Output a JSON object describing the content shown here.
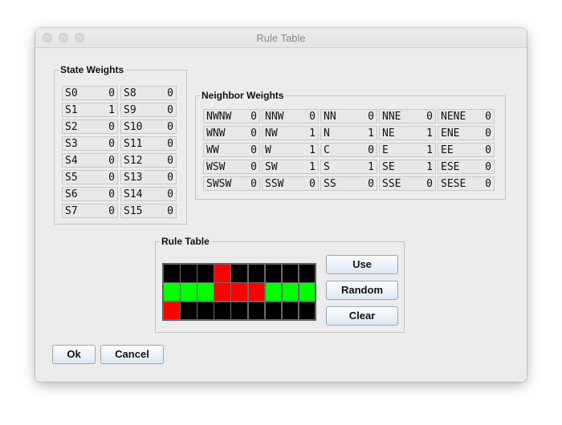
{
  "window": {
    "title": "Rule Table"
  },
  "state_weights": {
    "title": "State Weights",
    "left": [
      {
        "label": "S0",
        "value": "0"
      },
      {
        "label": "S1",
        "value": "1"
      },
      {
        "label": "S2",
        "value": "0"
      },
      {
        "label": "S3",
        "value": "0"
      },
      {
        "label": "S4",
        "value": "0"
      },
      {
        "label": "S5",
        "value": "0"
      },
      {
        "label": "S6",
        "value": "0"
      },
      {
        "label": "S7",
        "value": "0"
      }
    ],
    "right": [
      {
        "label": "S8",
        "value": "0"
      },
      {
        "label": "S9",
        "value": "0"
      },
      {
        "label": "S10",
        "value": "0"
      },
      {
        "label": "S11",
        "value": "0"
      },
      {
        "label": "S12",
        "value": "0"
      },
      {
        "label": "S13",
        "value": "0"
      },
      {
        "label": "S14",
        "value": "0"
      },
      {
        "label": "S15",
        "value": "0"
      }
    ]
  },
  "neighbor_weights": {
    "title": "Neighbor Weights",
    "rows": [
      [
        {
          "label": "NWNW",
          "value": "0"
        },
        {
          "label": "NNW",
          "value": "0"
        },
        {
          "label": "NN",
          "value": "0"
        },
        {
          "label": "NNE",
          "value": "0"
        },
        {
          "label": "NENE",
          "value": "0"
        }
      ],
      [
        {
          "label": "WNW",
          "value": "0"
        },
        {
          "label": "NW",
          "value": "1"
        },
        {
          "label": "N",
          "value": "1"
        },
        {
          "label": "NE",
          "value": "1"
        },
        {
          "label": "ENE",
          "value": "0"
        }
      ],
      [
        {
          "label": "WW",
          "value": "0"
        },
        {
          "label": "W",
          "value": "1"
        },
        {
          "label": "C",
          "value": "0"
        },
        {
          "label": "E",
          "value": "1"
        },
        {
          "label": "EE",
          "value": "0"
        }
      ],
      [
        {
          "label": "WSW",
          "value": "0"
        },
        {
          "label": "SW",
          "value": "1"
        },
        {
          "label": "S",
          "value": "1"
        },
        {
          "label": "SE",
          "value": "1"
        },
        {
          "label": "ESE",
          "value": "0"
        }
      ],
      [
        {
          "label": "SWSW",
          "value": "0"
        },
        {
          "label": "SSW",
          "value": "0"
        },
        {
          "label": "SS",
          "value": "0"
        },
        {
          "label": "SSE",
          "value": "0"
        },
        {
          "label": "SESE",
          "value": "0"
        }
      ]
    ]
  },
  "rule_table": {
    "title": "Rule Table",
    "grid": [
      [
        "black",
        "black",
        "black",
        "red",
        "black",
        "black",
        "black",
        "black",
        "black"
      ],
      [
        "green",
        "green",
        "green",
        "red",
        "red",
        "red",
        "green",
        "green",
        "green"
      ],
      [
        "red",
        "black",
        "black",
        "black",
        "black",
        "black",
        "black",
        "black",
        "black"
      ]
    ],
    "colors": {
      "black": "#000000",
      "green": "#00ff00",
      "red": "#ff0000"
    },
    "buttons": {
      "use": "Use",
      "random": "Random",
      "clear": "Clear"
    }
  },
  "footer": {
    "ok": "Ok",
    "cancel": "Cancel"
  }
}
